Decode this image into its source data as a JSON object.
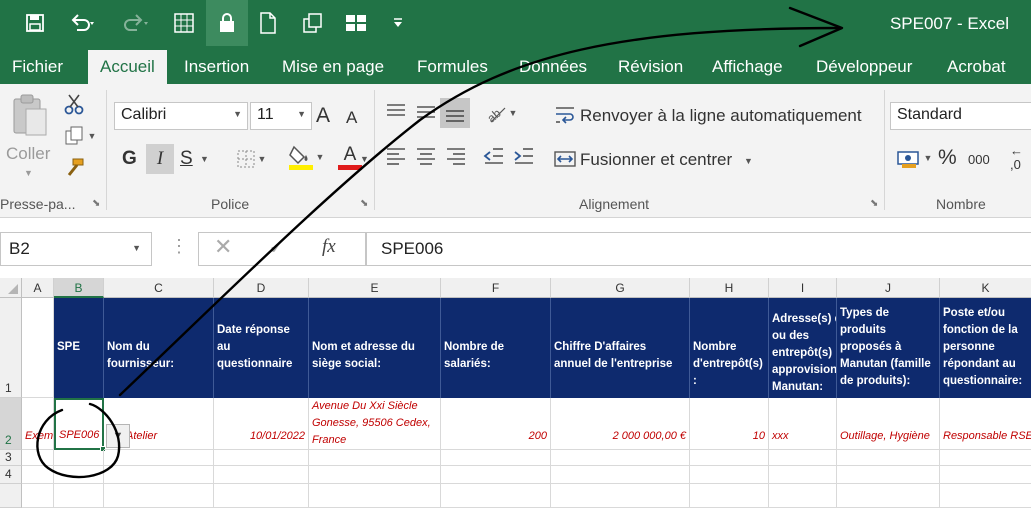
{
  "window": {
    "title": "SPE007 - Excel"
  },
  "qat": {
    "icons": [
      "save-icon",
      "undo-icon",
      "redo-icon",
      "form-icon",
      "lock-icon",
      "new-doc-icon",
      "copy-icon",
      "windows-icon",
      "customize-icon"
    ]
  },
  "tabs": [
    "Fichier",
    "Accueil",
    "Insertion",
    "Mise en page",
    "Formules",
    "Données",
    "Révision",
    "Affichage",
    "Développeur",
    "Acrobat"
  ],
  "ribbon": {
    "clipboard": {
      "paste_label": "Coller",
      "group_label": "Presse-pa..."
    },
    "font": {
      "name": "Calibri",
      "size": "11",
      "grow_label": "A",
      "shrink_label": "A",
      "bold": "G",
      "italic": "I",
      "underline": "S",
      "font_color_label": "A",
      "group_label": "Police"
    },
    "alignment": {
      "wrap_label": "Renvoyer à la ligne automatiquement",
      "merge_label": "Fusionner et centrer",
      "group_label": "Alignement"
    },
    "number": {
      "format": "Standard",
      "percent_label": "%",
      "thousands_label": "000",
      "group_label": "Nombre"
    }
  },
  "formula_bar": {
    "name_box": "B2",
    "fx_label": "fx",
    "content": "SPE006"
  },
  "sheet": {
    "columns": [
      "A",
      "B",
      "C",
      "D",
      "E",
      "F",
      "G",
      "H",
      "I",
      "J",
      "K"
    ],
    "rows": [
      "1",
      "2",
      "3",
      "4"
    ],
    "header_row": [
      "",
      "SPE",
      "Nom du fournisseur:",
      "Date réponse au questionnaire",
      "Nom et adresse du siège social:",
      "Nombre de salariés:",
      "Chiffre D'affaires annuel de l'entreprise",
      "Nombre d'entrepôt(s) :",
      "Adresse(s) du ou des entrepôt(s) approvisionnant Manutan:",
      "Types de produits proposés à Manutan  (famille de produits):",
      "Poste et/ou fonction de la personne répondant au questionnaire:"
    ],
    "data_row": [
      "Exem",
      "SPE006",
      "Atelier",
      "10/01/2022",
      "Avenue Du Xxi Siècle Gonesse, 95506 Cedex, France",
      "200",
      "2 000 000,00 €",
      "10",
      "xxx",
      "Outillage, Hygiène",
      "Responsable RSE"
    ]
  },
  "colors": {
    "excel_green": "#217346",
    "header_fill": "#0e2a6e",
    "data_text": "#c00000"
  }
}
